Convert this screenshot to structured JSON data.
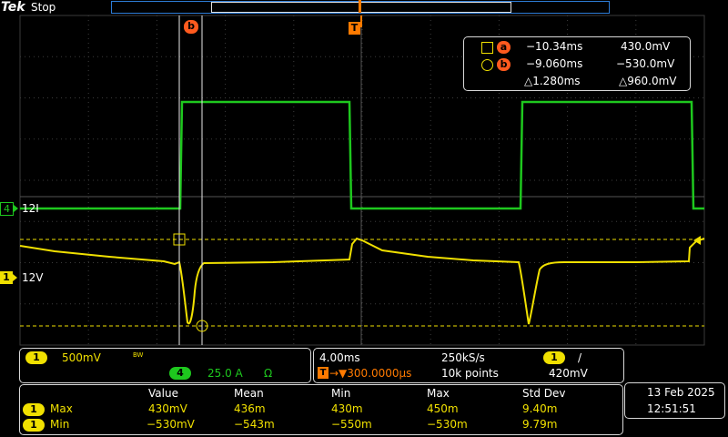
{
  "header": {
    "brand": "Tek",
    "run_state": "Stop",
    "trigger_marker": "T"
  },
  "cursor_labels": {
    "a": "a",
    "b": "b"
  },
  "cursor_readout": {
    "a": {
      "time": "−10.34ms",
      "value": "430.0mV"
    },
    "b": {
      "time": "−9.060ms",
      "value": "−530.0mV"
    },
    "delta": {
      "time": "△1.280ms",
      "value": "△960.0mV"
    }
  },
  "channels": {
    "ch4": {
      "number": "4",
      "label": "12I",
      "color": "#1ec81e"
    },
    "ch1": {
      "number": "1",
      "label": "12V",
      "color": "#f0e000"
    }
  },
  "vertical_panel": {
    "ch1_number": "1",
    "ch1_scale": "500mV",
    "bw_mark": "BW",
    "ch4_number": "4",
    "ch4_scale": "25.0 A",
    "ch4_termination": "Ω"
  },
  "horizontal_panel": {
    "timebase": "4.00ms",
    "sample_rate": "250kS/s",
    "trigger_position_label": "T",
    "trigger_position": "→▼300.0000µs",
    "record_length": "10k points",
    "trigger_channel": "1",
    "trigger_slope": "/",
    "trigger_level": "420mV"
  },
  "measurements": {
    "headers": [
      "Value",
      "Mean",
      "Min",
      "Max",
      "Std Dev"
    ],
    "rows": [
      {
        "channel": "1",
        "name": "Max",
        "values": [
          "430mV",
          "436m",
          "430m",
          "450m",
          "9.40m"
        ]
      },
      {
        "channel": "1",
        "name": "Min",
        "values": [
          "−530mV",
          "−543m",
          "−550m",
          "−530m",
          "9.79m"
        ]
      }
    ]
  },
  "datetime": {
    "date": "13 Feb  2025",
    "time": "12:51:51"
  },
  "colors": {
    "ch1": "#f0e000",
    "ch4": "#1ec81e",
    "cursor": "#ff5a1e",
    "trigger": "#ff7a00"
  }
}
